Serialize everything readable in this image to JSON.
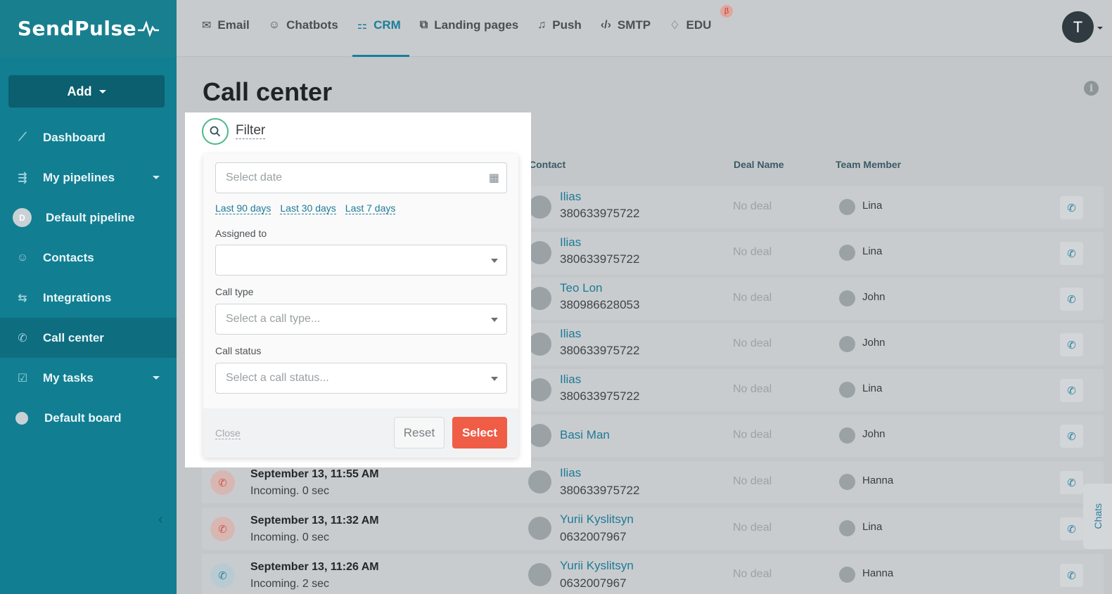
{
  "app": {
    "logo": "SendPulse"
  },
  "sidebar": {
    "add_label": "Add",
    "items": [
      {
        "label": "Dashboard",
        "icon": "chart-line-icon"
      },
      {
        "label": "My pipelines",
        "icon": "pipeline-icon"
      },
      {
        "label": "Default pipeline",
        "badge": "D"
      },
      {
        "label": "Contacts",
        "icon": "contacts-icon"
      },
      {
        "label": "Integrations",
        "icon": "integrations-icon"
      },
      {
        "label": "Call center",
        "icon": "phone-icon",
        "active": true
      },
      {
        "label": "My tasks",
        "icon": "tasks-icon"
      },
      {
        "label": "Default board",
        "icon": "dot-icon"
      }
    ]
  },
  "topnav": {
    "tabs": [
      {
        "label": "Email"
      },
      {
        "label": "Chatbots"
      },
      {
        "label": "CRM",
        "active": true
      },
      {
        "label": "Landing pages"
      },
      {
        "label": "Push"
      },
      {
        "label": "SMTP"
      },
      {
        "label": "EDU"
      }
    ],
    "beta": "β",
    "avatar_initial": "T"
  },
  "page": {
    "title": "Call center"
  },
  "table": {
    "headers": {
      "contact": "Contact",
      "deal": "Deal Name",
      "member": "Team Member"
    },
    "rows": [
      {
        "contact": "Ilias",
        "phone": "380633975722",
        "deal": "No deal",
        "member": "Lina"
      },
      {
        "contact": "Ilias",
        "phone": "380633975722",
        "deal": "No deal",
        "member": "Lina"
      },
      {
        "contact": "Teo Lon",
        "phone": "380986628053",
        "deal": "No deal",
        "member": "John"
      },
      {
        "contact": "Ilias",
        "phone": "380633975722",
        "deal": "No deal",
        "member": "John"
      },
      {
        "contact": "Ilias",
        "phone": "380633975722",
        "deal": "No deal",
        "member": "Lina"
      },
      {
        "contact": "Basi Man",
        "phone": "",
        "deal": "No deal",
        "member": "John"
      },
      {
        "when": "September 13, 11:55 AM",
        "duration": "Incoming. 0 sec",
        "contact": "Ilias",
        "phone": "380633975722",
        "deal": "No deal",
        "member": "Hanna"
      },
      {
        "when": "September 13, 11:32 AM",
        "duration": "Incoming. 0 sec",
        "contact": "Yurii Kyslitsyn",
        "phone": "0632007967",
        "deal": "No deal",
        "member": "Lina"
      },
      {
        "when": "September 13, 11:26 AM",
        "duration": "Incoming. 2 sec",
        "contact": "Yurii Kyslitsyn",
        "phone": "0632007967",
        "deal": "No deal",
        "member": "Hanna"
      }
    ]
  },
  "filter": {
    "title": "Filter",
    "date_placeholder": "Select date",
    "quick": [
      "Last 90 days",
      "Last 30 days",
      "Last 7 days"
    ],
    "assigned_label": "Assigned to",
    "assigned_value": "",
    "call_type_label": "Call type",
    "call_type_placeholder": "Select a call type...",
    "call_status_label": "Call status",
    "call_status_placeholder": "Select a call status...",
    "close_label": "Close",
    "reset_label": "Reset",
    "select_label": "Select"
  },
  "chats_label": "Chats",
  "colors": {
    "brand": "#117e92",
    "accent": "#ef5d47",
    "link": "#1e7a98",
    "missed": "#d35447"
  }
}
